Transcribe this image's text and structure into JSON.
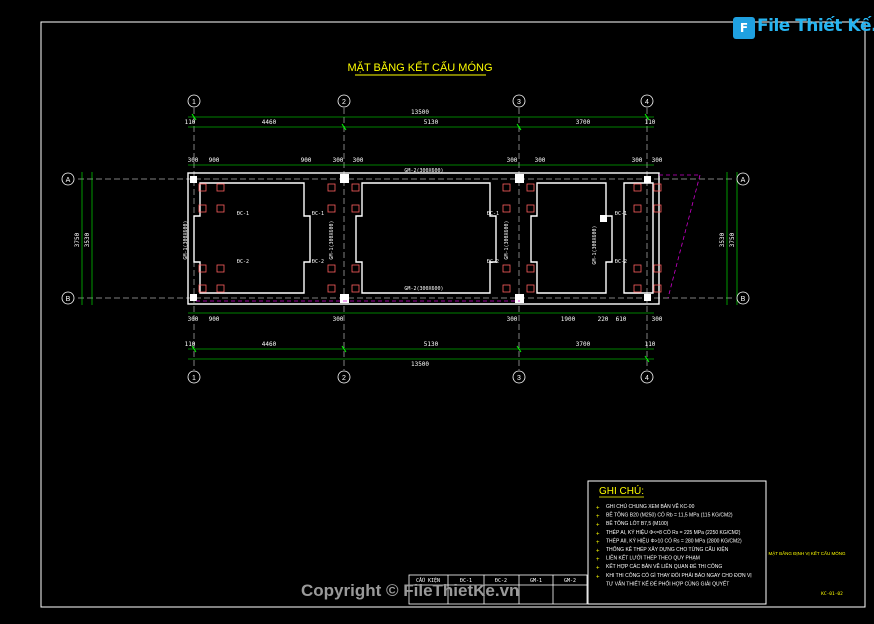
{
  "drawing_title": "MẶT BẰNG KẾT CẤU MÓNG",
  "grid_labels": {
    "columns": [
      "1",
      "2",
      "3",
      "4"
    ],
    "rows": [
      "A",
      "B"
    ]
  },
  "dimensions": {
    "overall": "13500",
    "spans_top": [
      "4460",
      "5130",
      "3700"
    ],
    "spans_bottom": [
      "4460",
      "5130",
      "3700"
    ],
    "edge": "110",
    "vertical_total": "3750",
    "vertical_inner": "3530",
    "small": [
      "300",
      "900",
      "1900",
      "220",
      "610"
    ]
  },
  "beam_labels": [
    "GM-2(300X600)",
    "GM-1(300X600)",
    "GM-2(300X600)"
  ],
  "footing_labels": [
    "ĐC-1",
    "ĐC-2",
    "ĐC-1",
    "ĐC-2"
  ],
  "notes": {
    "heading": "GHI CHÚ:",
    "items": [
      "GHI CHÚ CHUNG XEM BẢN VẼ KC-00",
      "BÊ TÔNG B20 (M250) CÓ Rb = 11,5 MPa (115 KG/CM2)",
      "BÊ TÔNG LÓT B7,5 (M100)",
      "THÉP AI, KÝ HIỆU Φ<=8 CÓ Rs = 225 MPa (2250 KG/CM2)",
      "THÉP AII, KÝ HIỆU Φ>10 CÓ Rs = 280 MPa (2800 KG/CM2)",
      "THỐNG KÊ THÉP XÂY DỰNG CHO TỪNG CẤU KIỆN",
      "LIÊN KẾT LƯỚI THÉP THEO QUY PHẠM",
      "KẾT HỢP CÁC BẢN VẼ LIÊN QUAN ĐỂ THI CÔNG",
      "KHI THI CÔNG CÓ GÌ THAY ĐỔI PHẢI BÁO NGAY CHO ĐƠN VỊ",
      "TƯ VẤN THIẾT KẾ ĐỂ PHỐI HỢP CÙNG GIẢI QUYẾT"
    ]
  },
  "schedule_table": {
    "headers": [
      "CẤU KIỆN",
      "ĐC-1",
      "ĐC-2",
      "GM-1",
      "GM-2"
    ]
  },
  "title_block": {
    "sheet_name": "MẶT BẰNG ĐỊNH VỊ KẾT CẤU MÓNG",
    "sheet_code": "KC-01-02"
  },
  "watermark": {
    "logo_mark": "F",
    "logo_text": "File Thiết Kế.vn",
    "copyright": "Copyright © FileThietKe.vn"
  },
  "colors": {
    "background": "#000000",
    "frame": "#ffffff",
    "title": "#ffff00",
    "dimension": "#00ff00",
    "wall": "#ffffff",
    "footing": "#ff6060",
    "grid_line": "#cc00cc",
    "notes_heading": "#ffff00",
    "notes_text": "#ffffff",
    "notes_bullet": "#ffff00"
  }
}
